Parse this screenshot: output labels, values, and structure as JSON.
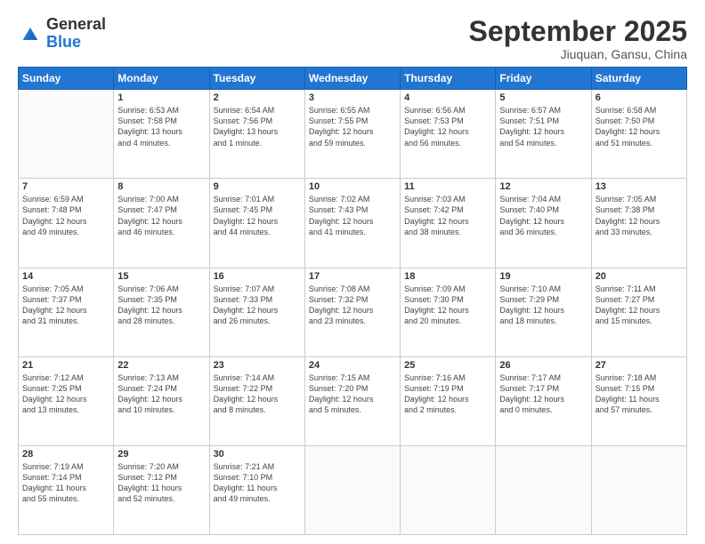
{
  "header": {
    "logo_general": "General",
    "logo_blue": "Blue",
    "month_title": "September 2025",
    "subtitle": "Jiuquan, Gansu, China"
  },
  "days_of_week": [
    "Sunday",
    "Monday",
    "Tuesday",
    "Wednesday",
    "Thursday",
    "Friday",
    "Saturday"
  ],
  "weeks": [
    [
      {
        "day": "",
        "info": ""
      },
      {
        "day": "1",
        "info": "Sunrise: 6:53 AM\nSunset: 7:58 PM\nDaylight: 13 hours\nand 4 minutes."
      },
      {
        "day": "2",
        "info": "Sunrise: 6:54 AM\nSunset: 7:56 PM\nDaylight: 13 hours\nand 1 minute."
      },
      {
        "day": "3",
        "info": "Sunrise: 6:55 AM\nSunset: 7:55 PM\nDaylight: 12 hours\nand 59 minutes."
      },
      {
        "day": "4",
        "info": "Sunrise: 6:56 AM\nSunset: 7:53 PM\nDaylight: 12 hours\nand 56 minutes."
      },
      {
        "day": "5",
        "info": "Sunrise: 6:57 AM\nSunset: 7:51 PM\nDaylight: 12 hours\nand 54 minutes."
      },
      {
        "day": "6",
        "info": "Sunrise: 6:58 AM\nSunset: 7:50 PM\nDaylight: 12 hours\nand 51 minutes."
      }
    ],
    [
      {
        "day": "7",
        "info": "Sunrise: 6:59 AM\nSunset: 7:48 PM\nDaylight: 12 hours\nand 49 minutes."
      },
      {
        "day": "8",
        "info": "Sunrise: 7:00 AM\nSunset: 7:47 PM\nDaylight: 12 hours\nand 46 minutes."
      },
      {
        "day": "9",
        "info": "Sunrise: 7:01 AM\nSunset: 7:45 PM\nDaylight: 12 hours\nand 44 minutes."
      },
      {
        "day": "10",
        "info": "Sunrise: 7:02 AM\nSunset: 7:43 PM\nDaylight: 12 hours\nand 41 minutes."
      },
      {
        "day": "11",
        "info": "Sunrise: 7:03 AM\nSunset: 7:42 PM\nDaylight: 12 hours\nand 38 minutes."
      },
      {
        "day": "12",
        "info": "Sunrise: 7:04 AM\nSunset: 7:40 PM\nDaylight: 12 hours\nand 36 minutes."
      },
      {
        "day": "13",
        "info": "Sunrise: 7:05 AM\nSunset: 7:38 PM\nDaylight: 12 hours\nand 33 minutes."
      }
    ],
    [
      {
        "day": "14",
        "info": "Sunrise: 7:05 AM\nSunset: 7:37 PM\nDaylight: 12 hours\nand 31 minutes."
      },
      {
        "day": "15",
        "info": "Sunrise: 7:06 AM\nSunset: 7:35 PM\nDaylight: 12 hours\nand 28 minutes."
      },
      {
        "day": "16",
        "info": "Sunrise: 7:07 AM\nSunset: 7:33 PM\nDaylight: 12 hours\nand 26 minutes."
      },
      {
        "day": "17",
        "info": "Sunrise: 7:08 AM\nSunset: 7:32 PM\nDaylight: 12 hours\nand 23 minutes."
      },
      {
        "day": "18",
        "info": "Sunrise: 7:09 AM\nSunset: 7:30 PM\nDaylight: 12 hours\nand 20 minutes."
      },
      {
        "day": "19",
        "info": "Sunrise: 7:10 AM\nSunset: 7:29 PM\nDaylight: 12 hours\nand 18 minutes."
      },
      {
        "day": "20",
        "info": "Sunrise: 7:11 AM\nSunset: 7:27 PM\nDaylight: 12 hours\nand 15 minutes."
      }
    ],
    [
      {
        "day": "21",
        "info": "Sunrise: 7:12 AM\nSunset: 7:25 PM\nDaylight: 12 hours\nand 13 minutes."
      },
      {
        "day": "22",
        "info": "Sunrise: 7:13 AM\nSunset: 7:24 PM\nDaylight: 12 hours\nand 10 minutes."
      },
      {
        "day": "23",
        "info": "Sunrise: 7:14 AM\nSunset: 7:22 PM\nDaylight: 12 hours\nand 8 minutes."
      },
      {
        "day": "24",
        "info": "Sunrise: 7:15 AM\nSunset: 7:20 PM\nDaylight: 12 hours\nand 5 minutes."
      },
      {
        "day": "25",
        "info": "Sunrise: 7:16 AM\nSunset: 7:19 PM\nDaylight: 12 hours\nand 2 minutes."
      },
      {
        "day": "26",
        "info": "Sunrise: 7:17 AM\nSunset: 7:17 PM\nDaylight: 12 hours\nand 0 minutes."
      },
      {
        "day": "27",
        "info": "Sunrise: 7:18 AM\nSunset: 7:15 PM\nDaylight: 11 hours\nand 57 minutes."
      }
    ],
    [
      {
        "day": "28",
        "info": "Sunrise: 7:19 AM\nSunset: 7:14 PM\nDaylight: 11 hours\nand 55 minutes."
      },
      {
        "day": "29",
        "info": "Sunrise: 7:20 AM\nSunset: 7:12 PM\nDaylight: 11 hours\nand 52 minutes."
      },
      {
        "day": "30",
        "info": "Sunrise: 7:21 AM\nSunset: 7:10 PM\nDaylight: 11 hours\nand 49 minutes."
      },
      {
        "day": "",
        "info": ""
      },
      {
        "day": "",
        "info": ""
      },
      {
        "day": "",
        "info": ""
      },
      {
        "day": "",
        "info": ""
      }
    ]
  ]
}
